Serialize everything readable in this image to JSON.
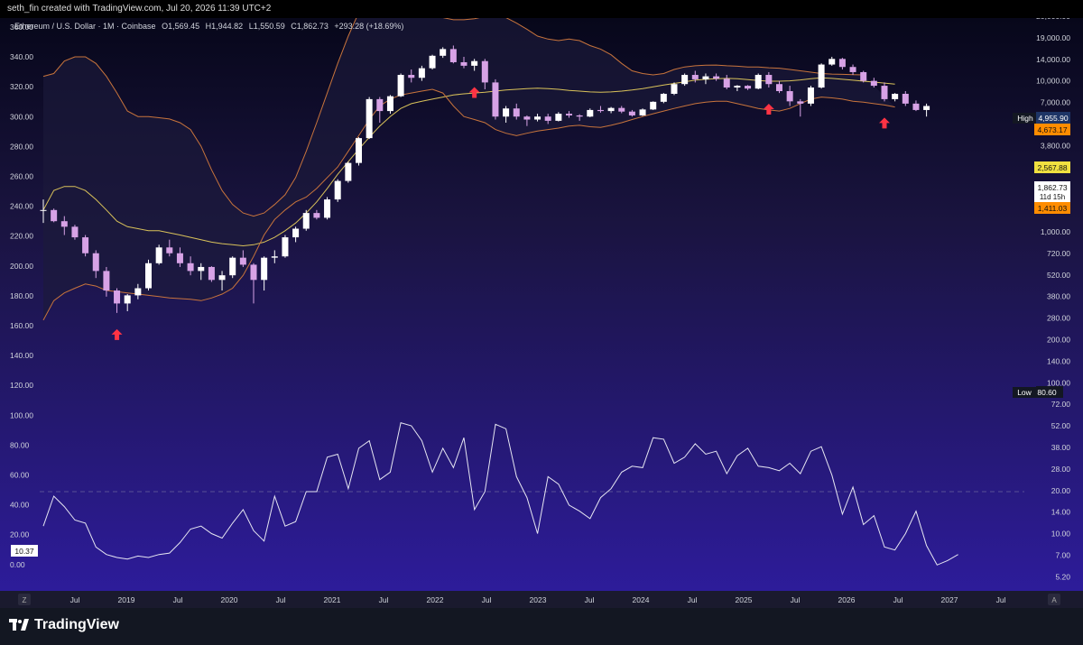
{
  "header": {
    "credit": "seth_fin created with TradingView.com, Jul 20, 2026 11:39 UTC+2"
  },
  "legend": {
    "symbol": "Ethereum / U.S. Dollar · 1M · Coinbase",
    "o_label": "O",
    "o": "1,569.45",
    "h_label": "H",
    "h": "1,944.82",
    "l_label": "L",
    "l": "1,550.59",
    "c_label": "C",
    "c": "1,862.73",
    "change": "+293.28 (+18.69%)"
  },
  "right_axis": {
    "ticks": [
      "20,000.00",
      "19,000.00",
      "14,000.00",
      "10,000.00",
      "7,000.00",
      "5,000.00",
      "3,800.00",
      "2,800.00",
      "2,000.00",
      "1,400.00",
      "1,000.00",
      "720.00",
      "520.00",
      "380.00",
      "280.00",
      "200.00",
      "140.00",
      "100.00",
      "72.00",
      "52.00",
      "38.00",
      "28.00",
      "20.00",
      "14.00",
      "10.00",
      "7.00",
      "5.20"
    ],
    "high_label": "High",
    "high_value": "4,955.90",
    "low_label": "Low",
    "low_value": "80.60",
    "price_orange_top": "4,673.17",
    "price_yellow": "2,567.88",
    "price_current": "1,862.73",
    "countdown": "11d 15h",
    "price_orange_bottom": "1,411.03"
  },
  "left_axis": {
    "ticks": [
      "360.00",
      "340.00",
      "320.00",
      "300.00",
      "280.00",
      "260.00",
      "240.00",
      "220.00",
      "200.00",
      "180.00",
      "160.00",
      "140.00",
      "120.00",
      "100.00",
      "80.00",
      "60.00",
      "40.00",
      "20.00",
      "0.00"
    ],
    "rsi_value": "10.37"
  },
  "time_axis": {
    "labels": [
      "Jul",
      "2019",
      "Jul",
      "2020",
      "Jul",
      "2021",
      "Jul",
      "2022",
      "Jul",
      "2023",
      "Jul",
      "2024",
      "Jul",
      "2025",
      "Jul",
      "2026",
      "Jul",
      "2027",
      "Jul"
    ],
    "left_button": "Z",
    "right_button": "A"
  },
  "footer": {
    "brand": "TradingView"
  },
  "colors": {
    "up": "#ffffff",
    "down": "#d7a2e6",
    "bands": "#c8743c",
    "basis": "#d9c25a",
    "rsi": "#e6e6f2",
    "arrow": "#ff3344",
    "orange": "#ff8c00",
    "yellow": "#f0e040"
  },
  "chart_data": [
    {
      "type": "candlestick",
      "title": "Ethereum / U.S. Dollar · 1M · Coinbase",
      "y_scale": "log",
      "series": [
        {
          "name": "ETH/USD",
          "ohlc": [
            [
              2000,
              2400,
              1600,
              2000
            ],
            [
              2000,
              2050,
              1620,
              1650
            ],
            [
              1650,
              1800,
              1300,
              1500
            ],
            [
              1500,
              1550,
              1200,
              1250
            ],
            [
              1250,
              1300,
              900,
              950
            ],
            [
              950,
              1000,
              620,
              700
            ],
            [
              700,
              750,
              450,
              500
            ],
            [
              500,
              520,
              340,
              400
            ],
            [
              400,
              470,
              350,
              460
            ],
            [
              460,
              560,
              430,
              520
            ],
            [
              520,
              850,
              500,
              800
            ],
            [
              800,
              1100,
              780,
              1050
            ],
            [
              1050,
              1200,
              900,
              950
            ],
            [
              950,
              1050,
              750,
              800
            ],
            [
              800,
              900,
              650,
              700
            ],
            [
              700,
              800,
              600,
              750
            ],
            [
              750,
              760,
              580,
              600
            ],
            [
              600,
              700,
              500,
              650
            ],
            [
              650,
              900,
              620,
              880
            ],
            [
              880,
              1000,
              750,
              780
            ],
            [
              780,
              800,
              400,
              600
            ],
            [
              600,
              900,
              500,
              880
            ],
            [
              880,
              1000,
              800,
              900
            ],
            [
              900,
              1300,
              880,
              1250
            ],
            [
              1250,
              1500,
              1150,
              1450
            ],
            [
              1450,
              2000,
              1400,
              1900
            ],
            [
              1900,
              2000,
              1700,
              1750
            ],
            [
              1750,
              2500,
              1700,
              2400
            ],
            [
              2400,
              3400,
              2300,
              3300
            ],
            [
              3300,
              4600,
              3200,
              4500
            ],
            [
              4500,
              7000,
              4300,
              6900
            ],
            [
              6900,
              14000,
              6800,
              13500
            ],
            [
              13500,
              14000,
              9000,
              11000
            ],
            [
              11000,
              14500,
              10500,
              14200
            ],
            [
              14200,
              21000,
              14000,
              20500
            ],
            [
              20500,
              22500,
              18000,
              19500
            ],
            [
              19500,
              24000,
              18500,
              23000
            ],
            [
              23000,
              29000,
              22500,
              28500
            ],
            [
              28500,
              33000,
              27500,
              32000
            ],
            [
              32000,
              34000,
              25000,
              25500
            ],
            [
              25500,
              28000,
              23000,
              24000
            ],
            [
              24000,
              27000,
              22000,
              26000
            ],
            [
              26000,
              27000,
              16000,
              18000
            ],
            [
              18000,
              19000,
              9500,
              10000
            ],
            [
              10000,
              12000,
              9000,
              11500
            ],
            [
              11500,
              12500,
              9500,
              10000
            ],
            [
              10000,
              10200,
              8500,
              9500
            ],
            [
              9500,
              10500,
              9200,
              10000
            ],
            [
              10000,
              10500,
              8800,
              9300
            ],
            [
              9300,
              10800,
              9200,
              10500
            ],
            [
              10500,
              11000,
              9800,
              10200
            ],
            [
              10200,
              10400,
              9300,
              10000
            ],
            [
              10000,
              11500,
              9900,
              11200
            ],
            [
              11200,
              12000,
              10700,
              11000
            ],
            [
              11000,
              11800,
              10600,
              11600
            ],
            [
              11600,
              12000,
              10600,
              10900
            ],
            [
              10900,
              11200,
              10000,
              10200
            ],
            [
              10200,
              11500,
              10100,
              11300
            ],
            [
              11300,
              13000,
              11200,
              12900
            ],
            [
              12900,
              15000,
              12600,
              14800
            ],
            [
              14800,
              18000,
              14500,
              17500
            ],
            [
              17500,
              21000,
              17000,
              20500
            ],
            [
              20500,
              22000,
              18000,
              19000
            ],
            [
              19000,
              21000,
              17500,
              20000
            ],
            [
              20000,
              21000,
              18500,
              19200
            ],
            [
              19200,
              20500,
              16000,
              16500
            ],
            [
              16500,
              17200,
              15500,
              17000
            ],
            [
              17000,
              17200,
              15800,
              16200
            ],
            [
              16200,
              21000,
              16000,
              20500
            ],
            [
              20500,
              21500,
              16500,
              17500
            ],
            [
              17500,
              18500,
              15000,
              15500
            ],
            [
              15500,
              17000,
              12000,
              13000
            ],
            [
              13000,
              13500,
              10000,
              12500
            ],
            [
              12500,
              17000,
              12000,
              16500
            ],
            [
              16500,
              25000,
              16200,
              24500
            ],
            [
              24500,
              28000,
              24000,
              27000
            ],
            [
              27000,
              27500,
              22500,
              23500
            ],
            [
              23500,
              24500,
              20500,
              21500
            ],
            [
              21500,
              22000,
              18000,
              18500
            ],
            [
              18500,
              19500,
              16500,
              17000
            ],
            [
              17000,
              18000,
              13000,
              13500
            ],
            [
              13500,
              15000,
              13000,
              14800
            ],
            [
              14800,
              15500,
              12000,
              12500
            ],
            [
              12500,
              13200,
              11000,
              11200
            ],
            [
              11200,
              12500,
              10000,
              12000
            ]
          ]
        }
      ]
    },
    {
      "type": "line",
      "title": "Bollinger Bands",
      "y_scale": "log",
      "series": [
        {
          "values": [
            20000,
            21000,
            26000,
            28000,
            28000,
            25000,
            20000,
            15000,
            11000,
            10000,
            10000,
            9800,
            9600,
            9000,
            8000,
            6000,
            4000,
            2800,
            2200,
            1900,
            1800,
            1900,
            2200,
            2600,
            3500,
            5500,
            9000,
            15000,
            25000,
            40000,
            60000,
            80000,
            95000,
            95000,
            92000,
            85000,
            75000,
            62000,
            55000,
            53000,
            53000,
            54000,
            56000,
            58000,
            55000,
            50000,
            45000,
            40000,
            38000,
            37000,
            38000,
            37000,
            34000,
            32000,
            29000,
            25000,
            22000,
            21000,
            20500,
            21000,
            22500,
            23500,
            24000,
            24200,
            24300,
            24000,
            23800,
            23500,
            23500,
            23200,
            23000,
            22500,
            22000,
            21500,
            21000,
            20800,
            20700,
            20600,
            20500
          ]
        },
        {
          "values": [
            2000,
            2800,
            3000,
            3000,
            2800,
            2400,
            2000,
            1650,
            1500,
            1450,
            1400,
            1400,
            1350,
            1300,
            1250,
            1200,
            1150,
            1120,
            1100,
            1080,
            1100,
            1150,
            1250,
            1400,
            1600,
            1900,
            2300,
            2900,
            3700,
            4600,
            5700,
            7000,
            8500,
            10000,
            11500,
            12500,
            13000,
            13500,
            14000,
            14500,
            14800,
            15000,
            15200,
            15500,
            15800,
            16000,
            16200,
            16300,
            16200,
            16000,
            15700,
            15500,
            15300,
            15200,
            15300,
            15500,
            15800,
            16200,
            16700,
            17200,
            17700,
            18200,
            18700,
            19000,
            19200,
            19300,
            19200,
            18900,
            18600,
            18400,
            18400,
            18500,
            18800,
            19200,
            19500,
            19300,
            19000,
            18700,
            18400,
            18100,
            17800,
            17500
          ]
        },
        {
          "values": [
            300,
            420,
            480,
            520,
            560,
            540,
            500,
            490,
            480,
            470,
            460,
            450,
            440,
            435,
            430,
            420,
            440,
            470,
            520,
            650,
            900,
            1300,
            1700,
            2000,
            2300,
            2500,
            2900,
            3500,
            4200,
            5500,
            7200,
            9500,
            12000,
            13500,
            14500,
            15000,
            15500,
            16000,
            15000,
            12000,
            10000,
            9500,
            9000,
            8000,
            7500,
            7200,
            7500,
            7800,
            8000,
            8200,
            8500,
            8600,
            8400,
            8300,
            8600,
            9000,
            9500,
            10000,
            10500,
            11000,
            11500,
            12000,
            12500,
            12800,
            13000,
            13000,
            12500,
            12000,
            11500,
            11200,
            11000,
            11500,
            12500,
            13500,
            14000,
            13800,
            13500,
            13000,
            12800,
            12500,
            12200,
            11800
          ]
        }
      ]
    },
    {
      "type": "line",
      "title": "RSI",
      "ylim": [
        0,
        100
      ],
      "series": [
        {
          "values": [
            27,
            47,
            40,
            31,
            29,
            13,
            8,
            6,
            5,
            7,
            6,
            8,
            9,
            16,
            25,
            27,
            22,
            19,
            29,
            38,
            24,
            17,
            47,
            27,
            30,
            50,
            50,
            73,
            75,
            52,
            79,
            84,
            58,
            63,
            96,
            94,
            84,
            63,
            79,
            66,
            86,
            38,
            50,
            95,
            92,
            60,
            46,
            22,
            60,
            55,
            41,
            37,
            32,
            46,
            52,
            63,
            67,
            66,
            86,
            85,
            69,
            73,
            82,
            75,
            77,
            62,
            74,
            79,
            67,
            66,
            64,
            69,
            62,
            77,
            80,
            61,
            35,
            53,
            28,
            34,
            13,
            11,
            22,
            37,
            14,
            1,
            4,
            8
          ]
        }
      ]
    }
  ]
}
